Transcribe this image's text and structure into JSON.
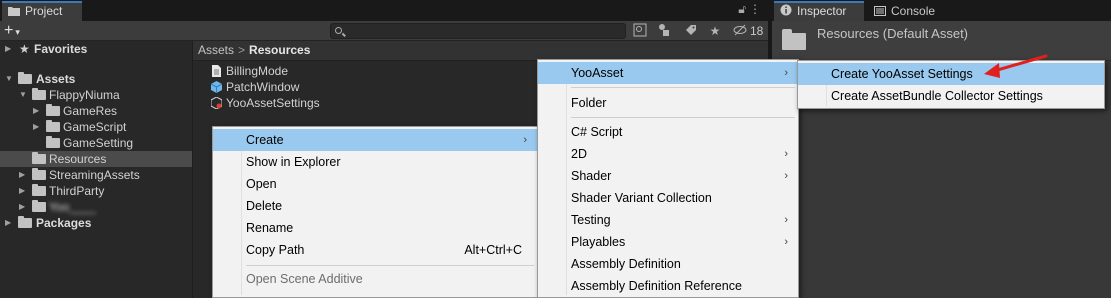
{
  "project": {
    "tab_title": "Project",
    "toolbar": {
      "add_label": "+",
      "hidden_count": "18"
    },
    "tree": [
      {
        "name": "favorites",
        "label": "Favorites"
      },
      {
        "name": "assets",
        "label": "Assets"
      },
      {
        "name": "flappyniuma",
        "label": "FlappyNiuma"
      },
      {
        "name": "gameres",
        "label": "GameRes"
      },
      {
        "name": "gamescript",
        "label": "GameScript"
      },
      {
        "name": "gamesetting",
        "label": "GameSetting"
      },
      {
        "name": "resources",
        "label": "Resources"
      },
      {
        "name": "streamingassets",
        "label": "StreamingAssets"
      },
      {
        "name": "thirdparty",
        "label": "ThirdParty"
      },
      {
        "name": "blurred",
        "label": "Yoo____"
      },
      {
        "name": "packages",
        "label": "Packages"
      }
    ],
    "breadcrumb": {
      "root": "Assets",
      "current": "Resources"
    },
    "files": [
      "BillingMode",
      "PatchWindow",
      "YooAssetSettings"
    ]
  },
  "inspector": {
    "tab_inspector": "Inspector",
    "tab_console": "Console",
    "asset_title": "Resources (Default Asset)"
  },
  "context_menu": {
    "items": [
      {
        "label": "Create",
        "submenu": true,
        "highlighted": true
      },
      {
        "label": "Show in Explorer"
      },
      {
        "label": "Open"
      },
      {
        "label": "Delete"
      },
      {
        "label": "Rename"
      },
      {
        "label": "Copy Path",
        "shortcut": "Alt+Ctrl+C"
      },
      {
        "label": "Open Scene Additive",
        "disabled": true
      }
    ]
  },
  "create_menu": {
    "items": [
      {
        "label": "YooAsset",
        "submenu": true,
        "highlighted": true
      },
      {
        "label": "Folder"
      },
      {
        "label": "C# Script"
      },
      {
        "label": "2D",
        "submenu": true
      },
      {
        "label": "Shader",
        "submenu": true
      },
      {
        "label": "Shader Variant Collection"
      },
      {
        "label": "Testing",
        "submenu": true
      },
      {
        "label": "Playables",
        "submenu": true
      },
      {
        "label": "Assembly Definition"
      },
      {
        "label": "Assembly Definition Reference"
      }
    ]
  },
  "yooasset_menu": {
    "items": [
      {
        "label": "Create YooAsset Settings",
        "highlighted": true
      },
      {
        "label": "Create AssetBundle Collector Settings"
      }
    ]
  },
  "colors": {
    "highlight": "#99c9ef",
    "annotation_arrow": "#e21f1f",
    "tab_accent": "#3a79bb"
  },
  "symbols": {
    "submenu_arrow": "›"
  }
}
